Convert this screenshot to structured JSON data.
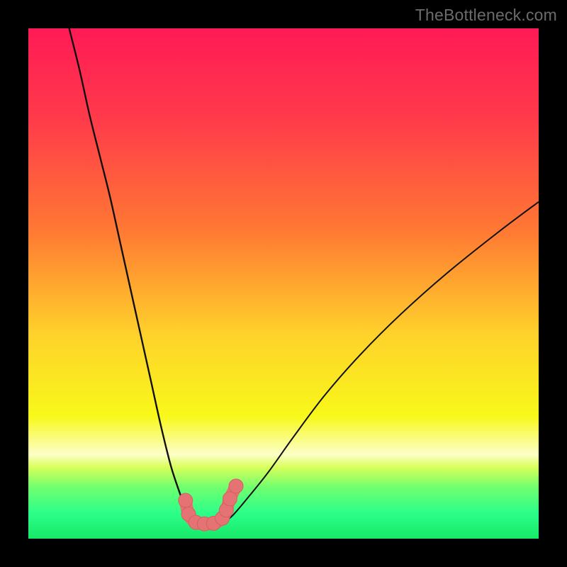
{
  "watermark": {
    "text": "TheBottleneck.com"
  },
  "colors": {
    "frame_bg": "#000000",
    "gradient_stops": [
      {
        "pos": 0.0,
        "color": "#ff1a56"
      },
      {
        "pos": 0.18,
        "color": "#ff3b4a"
      },
      {
        "pos": 0.4,
        "color": "#ff7a33"
      },
      {
        "pos": 0.6,
        "color": "#ffd22b"
      },
      {
        "pos": 0.76,
        "color": "#f8f81a"
      },
      {
        "pos": 0.835,
        "color": "#fcffc8"
      },
      {
        "pos": 0.86,
        "color": "#d8ff5a"
      },
      {
        "pos": 0.9,
        "color": "#6fff6f"
      },
      {
        "pos": 0.95,
        "color": "#2cff8a"
      },
      {
        "pos": 1.0,
        "color": "#17e867"
      }
    ],
    "curve_stroke": "#111111",
    "marker_fill": "#e57373",
    "marker_stroke": "#d46060"
  },
  "chart_data": {
    "type": "line",
    "title": "",
    "xlabel": "",
    "ylabel": "",
    "xlim": [
      0,
      100
    ],
    "ylim": [
      0,
      100
    ],
    "series": [
      {
        "name": "left-curve",
        "x": [
          8,
          10,
          12,
          14,
          16,
          18,
          20,
          22,
          24,
          26,
          28,
          30,
          31,
          32,
          33
        ],
        "y": [
          100,
          92,
          83,
          75,
          67,
          58,
          49,
          40,
          31,
          22,
          14,
          8,
          5,
          3.5,
          3
        ]
      },
      {
        "name": "right-curve",
        "x": [
          38,
          40,
          43,
          47,
          52,
          58,
          65,
          73,
          82,
          92,
          100
        ],
        "y": [
          3,
          4.5,
          8,
          13,
          20,
          28,
          36,
          44,
          52,
          60,
          66
        ]
      },
      {
        "name": "valley-dots",
        "x": [
          30.8,
          31.4,
          32.8,
          34.5,
          36.3,
          38.0,
          38.8,
          39.5,
          40.7
        ],
        "y": [
          7.5,
          4.8,
          3.2,
          2.9,
          3.0,
          4.0,
          5.6,
          7.8,
          10.3
        ]
      }
    ],
    "valley_path": {
      "x": [
        30.8,
        31.4,
        32.8,
        34.5,
        36.3,
        38.0,
        38.8,
        39.5,
        40.7
      ],
      "y": [
        7.5,
        4.8,
        3.2,
        2.9,
        3.0,
        4.0,
        5.6,
        7.8,
        10.3
      ]
    }
  }
}
